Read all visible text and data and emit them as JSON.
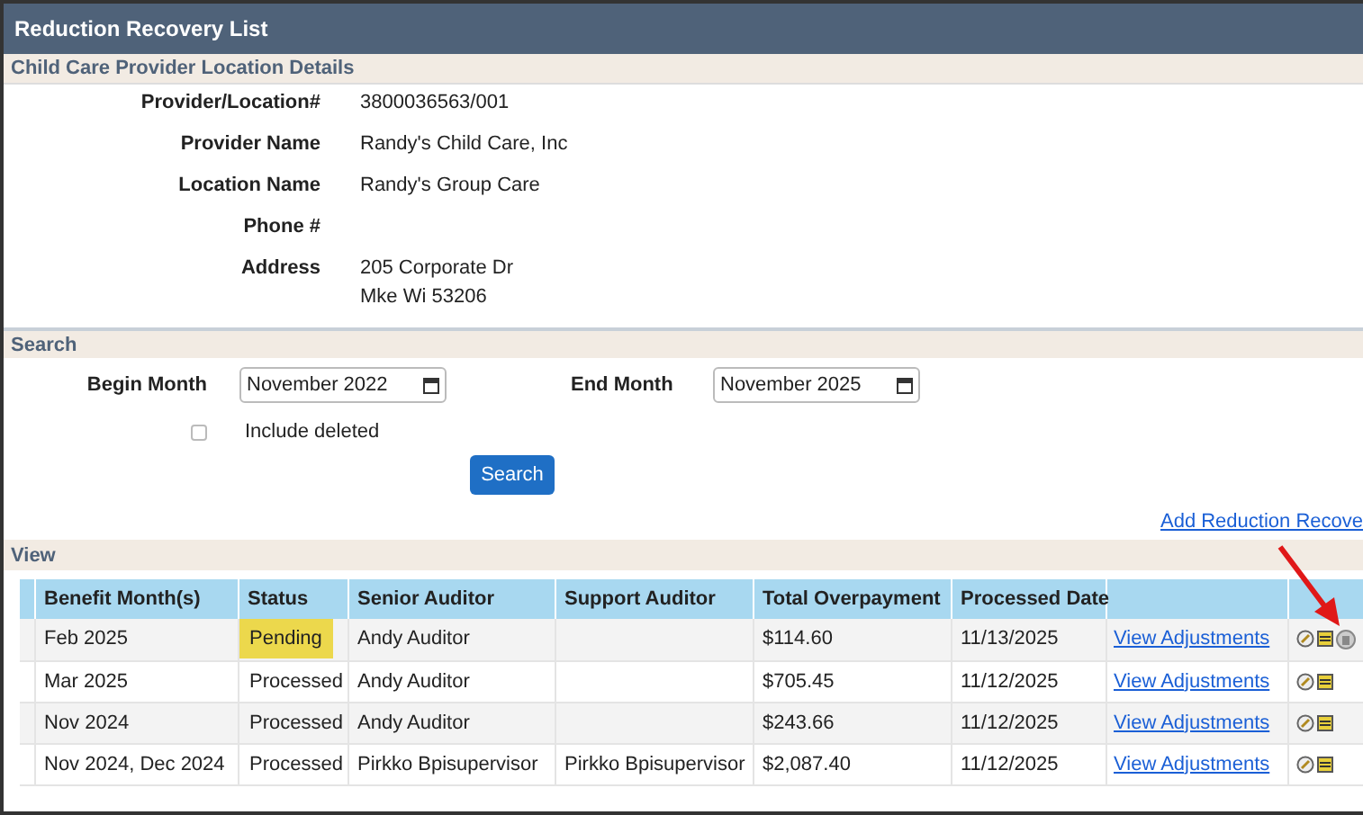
{
  "window": {
    "title": "Reduction Recovery List"
  },
  "details": {
    "title": "Child Care Provider Location Details",
    "fields": [
      {
        "label": "Provider/Location#",
        "lines": [
          "3800036563/001"
        ]
      },
      {
        "label": "Provider Name",
        "lines": [
          "Randy's Child Care, Inc"
        ]
      },
      {
        "label": "Location Name",
        "lines": [
          "Randy's Group Care"
        ]
      },
      {
        "label": "Phone #"
      },
      {
        "label": "Address",
        "lines": [
          "205 Corporate Dr",
          "Mke Wi 53206"
        ]
      }
    ]
  },
  "search": {
    "title": "Search",
    "begin_month": {
      "label": "Begin Month",
      "value": "November 2022"
    },
    "end_month": {
      "label": "End Month",
      "value": "November 2025"
    },
    "include_deleted": {
      "label": "Include deleted",
      "checked": false
    },
    "button": "Search",
    "add_link": "Add Reduction Recove"
  },
  "view": {
    "title": "View",
    "table": {
      "columns": [
        "Benefit Month(s)",
        "Status",
        "Senior Auditor",
        "Support Auditor",
        "Total Overpayment",
        "Processed Date"
      ],
      "rows": [
        {
          "benefit_months": "Feb 2025",
          "status": "Pending",
          "highlighted": true,
          "senior_auditor": "Andy Auditor",
          "total": "$114.60",
          "processed_date": "11/13/2025",
          "link": "View Adjustments",
          "deletable": true
        },
        {
          "benefit_months": "Mar 2025",
          "status": "Processed",
          "highlighted": false,
          "senior_auditor": "Andy Auditor",
          "total": "$705.45",
          "processed_date": "11/12/2025",
          "link": "View Adjustments",
          "deletable": false
        },
        {
          "benefit_months": "Nov 2024",
          "status": "Processed",
          "highlighted": false,
          "senior_auditor": "Andy Auditor",
          "total": "$243.66",
          "processed_date": "11/12/2025",
          "link": "View Adjustments",
          "deletable": false
        },
        {
          "benefit_months": "Nov 2024, Dec 2024",
          "status": "Processed",
          "highlighted": false,
          "senior_auditor": "Pirkko Bpisupervisor",
          "support_auditor": "Pirkko Bpisupervisor",
          "total": "$2,087.40",
          "processed_date": "11/12/2025",
          "link": "View Adjustments",
          "deletable": false
        }
      ]
    }
  }
}
